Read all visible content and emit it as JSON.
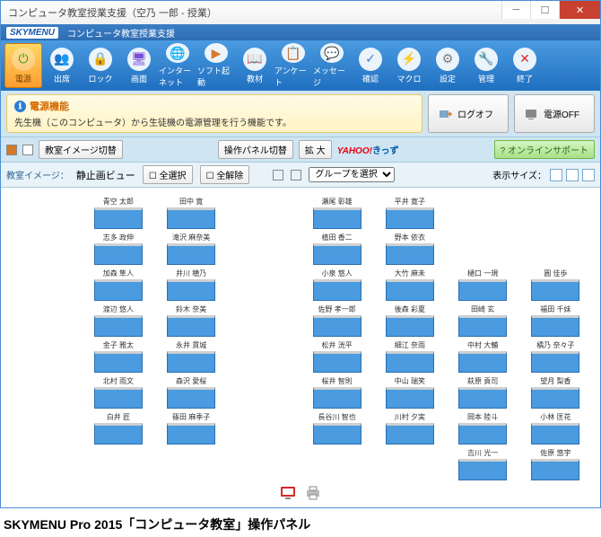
{
  "titlebar": {
    "title": "コンピュータ教室授業支援（空乃 一郎 - 授業）"
  },
  "menubar": {
    "logo": "SKYMENU",
    "label": "コンピュータ教室授業支援"
  },
  "toolbar": [
    {
      "icon": "⏻",
      "label": "電源",
      "name": "power",
      "active": true,
      "color": "#2a9d2a"
    },
    {
      "icon": "👥",
      "label": "出席",
      "name": "attendance",
      "color": "#2a7dd4"
    },
    {
      "icon": "🔒",
      "label": "ロック",
      "name": "lock",
      "color": "#d4a62a"
    },
    {
      "icon": "🖥",
      "label": "画面",
      "name": "screen",
      "color": "#7a4fd4"
    },
    {
      "icon": "🌐",
      "label": "インターネット",
      "name": "internet",
      "color": "#2a9dd4"
    },
    {
      "icon": "▶",
      "label": "ソフト起動",
      "name": "launch",
      "color": "#d47a2a"
    },
    {
      "icon": "📖",
      "label": "教材",
      "name": "materials",
      "color": "#d4542a"
    },
    {
      "icon": "📋",
      "label": "アンケート",
      "name": "survey",
      "color": "#2ad49d"
    },
    {
      "icon": "💬",
      "label": "メッセージ",
      "name": "message",
      "color": "#d42a7a"
    },
    {
      "icon": "✓",
      "label": "確認",
      "name": "confirm",
      "color": "#4f7ad4"
    },
    {
      "icon": "⚡",
      "label": "マクロ",
      "name": "macro",
      "color": "#9d7a2a"
    },
    {
      "icon": "⚙",
      "label": "設定",
      "name": "settings",
      "color": "#7a7a7a"
    },
    {
      "icon": "🔧",
      "label": "管理",
      "name": "admin",
      "color": "#5a9d2a"
    },
    {
      "icon": "✕",
      "label": "終了",
      "name": "exit",
      "color": "#d42a2a"
    }
  ],
  "info": {
    "title": "電源機能",
    "body": "先生機（このコンピュータ）から生徒機の電源管理を行う機能です。"
  },
  "actions": {
    "logoff": "ログオフ",
    "poweroff": "電源OFF"
  },
  "controlbar": {
    "switch_image": "教室イメージ切替",
    "switch_panel": "操作パネル切替",
    "zoom": "拡 大",
    "support": "オンラインサポート"
  },
  "subbar": {
    "image_label": "教室イメージ：",
    "image_value": "静止画ビュー",
    "select_all": "全選択",
    "deselect_all": "全解除",
    "group_select": "グループを選択",
    "size_label": "表示サイズ："
  },
  "seats": [
    [
      null,
      "青空 太郎",
      "田中 寛",
      null,
      "瀬尾 彰雄",
      "平井 寛子",
      null,
      null
    ],
    [
      null,
      "志多 政伸",
      "滝沢 麻奈美",
      null,
      "植田 香二",
      "野本 依衣",
      null,
      null
    ],
    [
      null,
      "加森 隼人",
      "井川 穂乃",
      null,
      "小泉 悠人",
      "大竹 麻未",
      "樋口 一規",
      "圓 佳歩"
    ],
    [
      null,
      "渡辺 悠人",
      "鈴木 奈美",
      null,
      "佐野 孝一郎",
      "後森 彩夏",
      "田崎 玄",
      "福田 千妹"
    ],
    [
      null,
      "金子 雅太",
      "永井 貫城",
      null,
      "松井 洸平",
      "細江 奈雨",
      "中村 大輔",
      "橘乃 奈々子"
    ],
    [
      null,
      "北村 雨文",
      "森沢 愛桜",
      null,
      "桜井 智則",
      "中山 瑞笑",
      "萩原 貢司",
      "望月 梨香"
    ],
    [
      null,
      "白井 匠",
      "篠田 麻季子",
      null,
      "長谷川 智也",
      "川村 夕実",
      "岡本 陸斗",
      "小林 匡花"
    ],
    [
      null,
      null,
      null,
      null,
      null,
      null,
      "吉川 光一",
      "佐原 悠宇"
    ]
  ],
  "caption": "SKYMENU Pro 2015「コンピュータ教室」操作パネル"
}
